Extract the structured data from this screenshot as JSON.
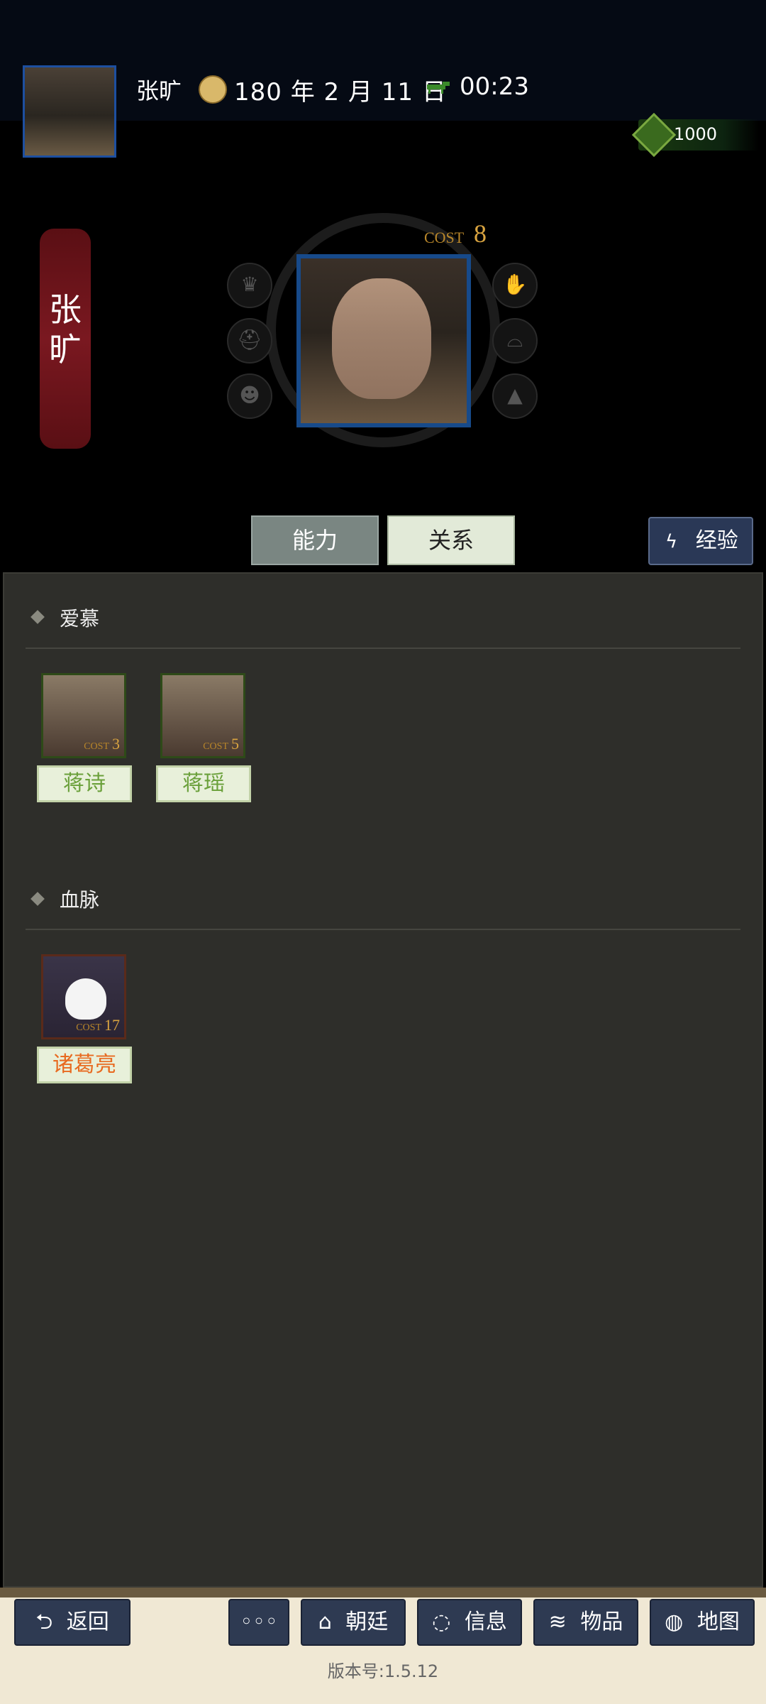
{
  "header": {
    "player_name": "张旷",
    "date": "180 年 2 月 11 日",
    "time": "00:23",
    "currency": "1000"
  },
  "character": {
    "name_vertical": "张旷",
    "cost_label": "COST",
    "cost_value": "8"
  },
  "tabs": {
    "ability": "能力",
    "relation": "关系",
    "experience": "经验"
  },
  "sections": {
    "love": {
      "title": "爱慕",
      "items": [
        {
          "name": "蒋诗",
          "cost": "3"
        },
        {
          "name": "蒋瑶",
          "cost": "5"
        }
      ]
    },
    "blood": {
      "title": "血脉",
      "items": [
        {
          "name": "诸葛亮",
          "cost": "17"
        }
      ]
    }
  },
  "bottom_nav": {
    "back": "返回",
    "more": "◦◦◦",
    "court": "朝廷",
    "info": "信息",
    "items": "物品",
    "map": "地图"
  },
  "version": "版本号:1.5.12",
  "icons": {
    "date": "sun-calendar-icon",
    "time": "horse-icon",
    "currency": "money-bag-icon",
    "side_left": [
      "crown-icon",
      "helmet-icon",
      "mask-icon"
    ],
    "side_right": [
      "hand-icon",
      "hat-icon",
      "graduation-cap-icon"
    ]
  }
}
